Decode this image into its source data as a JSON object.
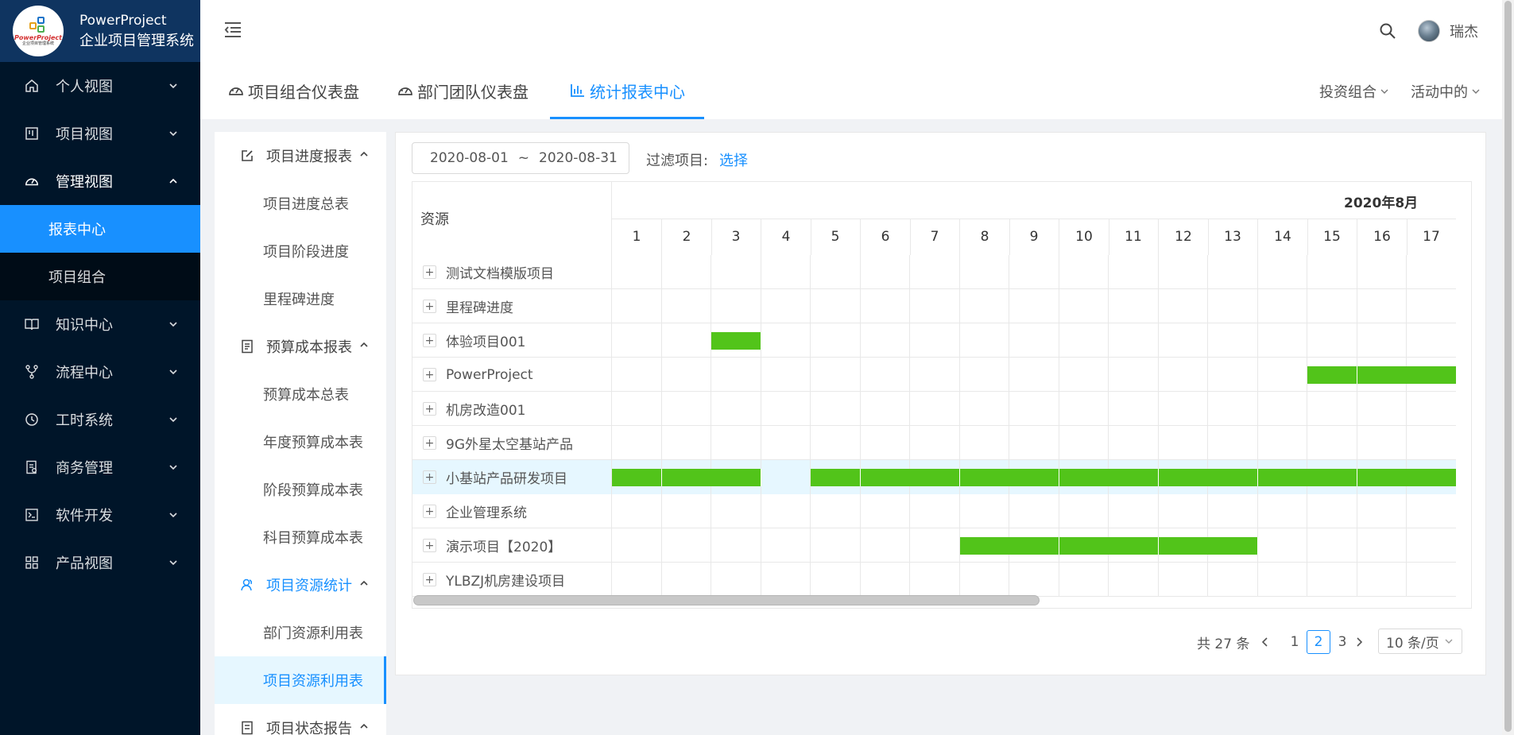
{
  "brand": {
    "logo_text": "PowerProject",
    "logo_sub": "企业项目管理系统",
    "title": "PowerProject",
    "subtitle": "企业项目管理系统"
  },
  "sidebar": {
    "items": [
      {
        "label": "个人视图",
        "icon": "home-icon"
      },
      {
        "label": "项目视图",
        "icon": "project-board-icon"
      },
      {
        "label": "管理视图",
        "icon": "dashboard-icon",
        "open": true,
        "children": [
          {
            "label": "报表中心",
            "active": true
          },
          {
            "label": "项目组合"
          }
        ]
      },
      {
        "label": "知识中心",
        "icon": "book-icon"
      },
      {
        "label": "流程中心",
        "icon": "workflow-icon"
      },
      {
        "label": "工时系统",
        "icon": "clock-icon"
      },
      {
        "label": "商务管理",
        "icon": "contract-icon"
      },
      {
        "label": "软件开发",
        "icon": "terminal-icon"
      },
      {
        "label": "产品视图",
        "icon": "grid-icon"
      }
    ]
  },
  "header": {
    "username": "瑞杰"
  },
  "tabs": [
    {
      "label": "项目组合仪表盘",
      "icon": "dashboard-icon"
    },
    {
      "label": "部门团队仪表盘",
      "icon": "dashboard-icon"
    },
    {
      "label": "统计报表中心",
      "icon": "bar-chart-icon",
      "active": true
    }
  ],
  "dropdowns": {
    "portfolio": "投资组合",
    "status": "活动中的"
  },
  "report_menu": [
    {
      "group": "项目进度报表",
      "icon": "edit-icon",
      "items": [
        "项目进度总表",
        "项目阶段进度",
        "里程碑进度"
      ]
    },
    {
      "group": "预算成本报表",
      "icon": "ledger-icon",
      "items": [
        "预算成本总表",
        "年度预算成本表",
        "阶段预算成本表",
        "科目预算成本表"
      ]
    },
    {
      "group": "项目资源统计",
      "icon": "team-icon",
      "active": true,
      "items": [
        "部门资源利用表",
        "项目资源利用表"
      ],
      "active_item": "项目资源利用表"
    },
    {
      "group": "项目状态报告",
      "icon": "report-icon",
      "items": []
    }
  ],
  "filter": {
    "date_start": "2020-08-01",
    "date_sep": "~",
    "date_end": "2020-08-31",
    "label": "过滤项目:",
    "link": "选择"
  },
  "table": {
    "resource_header": "资源",
    "month": "2020年8月",
    "days": [
      "1",
      "2",
      "3",
      "4",
      "5",
      "6",
      "7",
      "8",
      "9",
      "10",
      "11",
      "12",
      "13",
      "14",
      "15",
      "16",
      "17"
    ],
    "rows": [
      {
        "name": "测试文档模版项目",
        "busy_days": []
      },
      {
        "name": "里程碑进度",
        "busy_days": []
      },
      {
        "name": "体验项目001",
        "busy_days": [
          3
        ]
      },
      {
        "name": "PowerProject",
        "busy_days": [
          15,
          16,
          17
        ]
      },
      {
        "name": "机房改造001",
        "busy_days": []
      },
      {
        "name": "9G外星太空基站产品",
        "busy_days": []
      },
      {
        "name": "小基站产品研发项目",
        "busy_days": [
          1,
          2,
          3,
          5,
          6,
          7,
          8,
          9,
          10,
          11,
          12,
          13,
          14,
          15,
          16,
          17
        ],
        "highlighted": true
      },
      {
        "name": "企业管理系统",
        "busy_days": []
      },
      {
        "name": "演示项目【2020】",
        "busy_days": [
          8,
          9,
          10,
          11,
          12,
          13
        ]
      },
      {
        "name": "YLBZJ机房建设项目",
        "busy_days": []
      }
    ],
    "bar_color": "#52c41a"
  },
  "pagination": {
    "total": "共 27 条",
    "pages": [
      "1",
      "2",
      "3"
    ],
    "current": "2",
    "page_size": "10 条/页"
  },
  "colors": {
    "accent": "#1890ff",
    "sidebar_bg": "#001529",
    "brand_bg": "#0f3460"
  }
}
